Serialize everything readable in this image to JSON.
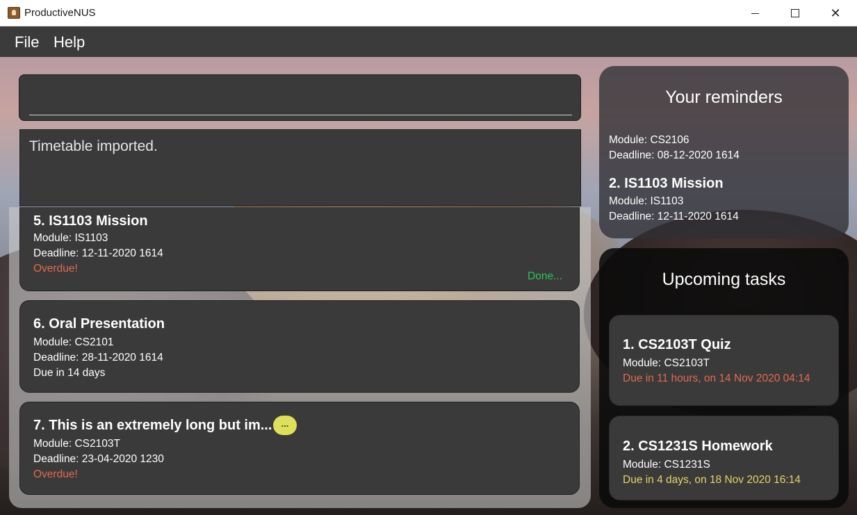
{
  "window": {
    "title": "ProductiveNUS"
  },
  "menu": {
    "file": "File",
    "help": "Help"
  },
  "command": {
    "value": "",
    "placeholder": ""
  },
  "result": {
    "text": "Timetable imported."
  },
  "task_list": [
    {
      "title": "5.  IS1103 Mission",
      "module": "Module: IS1103",
      "deadline": "Deadline: 12-11-2020 1614",
      "status": "Overdue!",
      "done_label": "Done..."
    },
    {
      "title": "6.  Oral Presentation",
      "module": "Module: CS2101",
      "deadline": "Deadline: 28-11-2020 1614",
      "status": "Due in 14 days"
    },
    {
      "title": "7.  This is an extremely long but im...",
      "module": "Module: CS2103T",
      "deadline": "Deadline: 23-04-2020 1230",
      "status": "Overdue!",
      "more_label": "..."
    }
  ],
  "reminders": {
    "heading": "Your reminders",
    "items": [
      {
        "module": "Module: CS2106",
        "deadline": "Deadline: 08-12-2020 1614"
      },
      {
        "title": "2.  IS1103 Mission",
        "module": "Module: IS1103",
        "deadline": "Deadline: 12-11-2020 1614"
      }
    ]
  },
  "upcoming": {
    "heading": "Upcoming tasks",
    "items": [
      {
        "title": "1.  CS2103T Quiz",
        "module": "Module: CS2103T",
        "due": "Due in 11 hours, on 14 Nov 2020 04:14"
      },
      {
        "title": "2.  CS1231S Homework",
        "module": "Module: CS1231S",
        "due": "Due in 4 days, on 18 Nov 2020 16:14"
      }
    ]
  },
  "colors": {
    "overdue": "#e06b50",
    "done": "#29c45a",
    "due_soon": "#e3d36a",
    "panel": "#3a3a3a"
  }
}
